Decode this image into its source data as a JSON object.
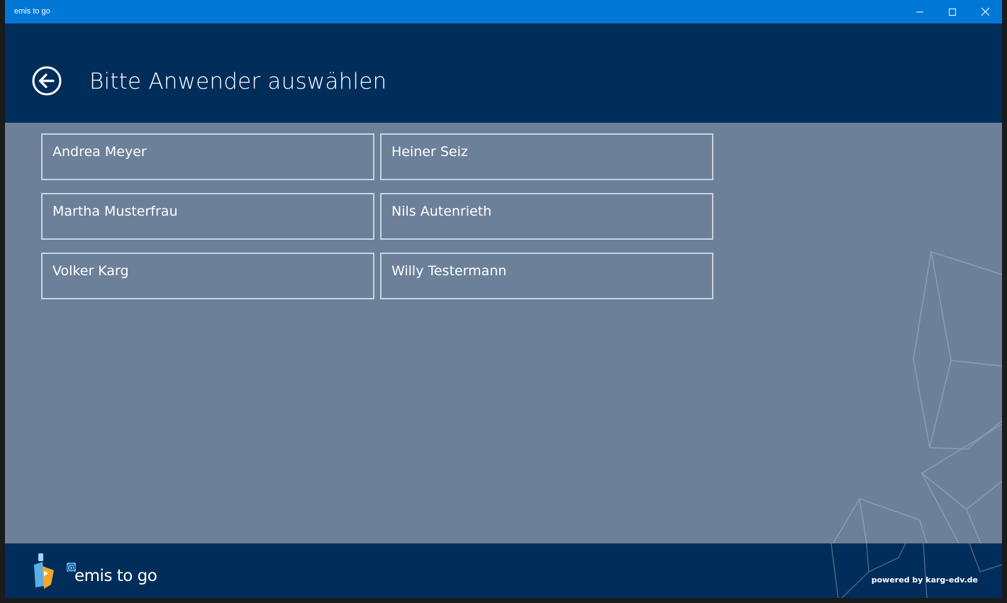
{
  "window": {
    "title": "emis to go",
    "controls": [
      "minimize-icon",
      "maximize-icon",
      "close-icon"
    ]
  },
  "header": {
    "back_icon": "back-arrow-icon",
    "title": "Bitte Anwender auswählen"
  },
  "users": [
    "Andrea Meyer",
    "Heiner Seiz",
    "Martha Musterfrau",
    "Nils Autenrieth",
    "Volker Karg",
    "Willy Testermann"
  ],
  "footer": {
    "app_name": "emis to go",
    "powered_by": "powered by karg-edv.de",
    "logo": "emis-logo-icon"
  },
  "colors": {
    "titlebar": "#0078d7",
    "header": "#002d5a",
    "content": "#6c8099",
    "tile_border": "#c9d3df",
    "text": "#ffffff"
  }
}
